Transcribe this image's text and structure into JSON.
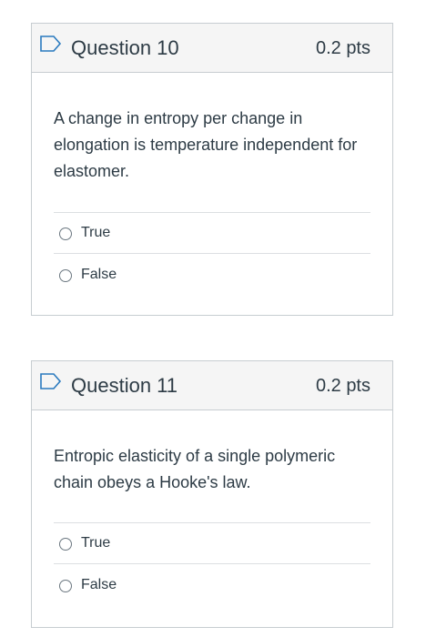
{
  "questions": [
    {
      "title": "Question 10",
      "points": "0.2 pts",
      "flag_icon": "bookmark-flag-icon",
      "text": "A change in entropy per change in elongation is temperature independent for elastomer.",
      "answers": [
        "True",
        "False"
      ]
    },
    {
      "title": "Question 11",
      "points": "0.2 pts",
      "flag_icon": "bookmark-flag-icon",
      "text": "Entropic elasticity of a single polymeric chain obeys a Hooke's law.",
      "answers": [
        "True",
        "False"
      ]
    }
  ]
}
